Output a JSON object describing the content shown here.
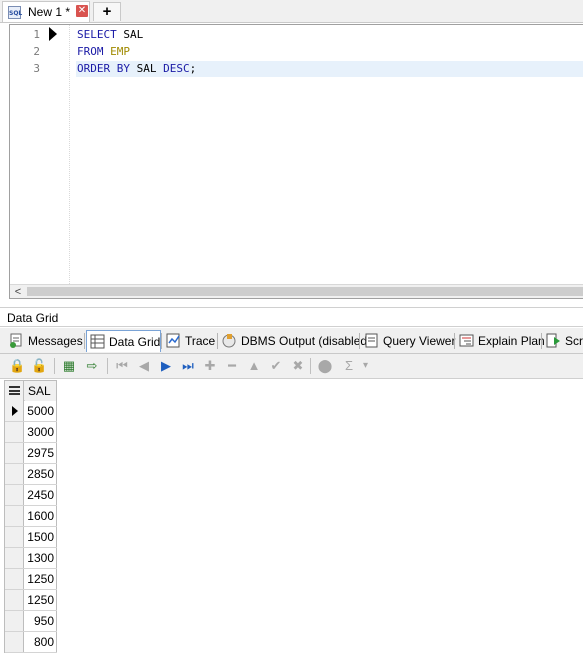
{
  "tab": {
    "sql_icon_text": "SQL",
    "label": "New 1 *",
    "close": "✕",
    "new_tab": "+"
  },
  "editor": {
    "lines": [
      {
        "num": "1",
        "parts": [
          {
            "t": "SELECT",
            "k": "kw"
          },
          {
            "t": " SAL",
            "k": "plain"
          }
        ]
      },
      {
        "num": "2",
        "parts": [
          {
            "t": "FROM",
            "k": "kw"
          },
          {
            "t": " EMP",
            "k": "tbl"
          }
        ]
      },
      {
        "num": "3",
        "parts": [
          {
            "t": "ORDER BY",
            "k": "kw"
          },
          {
            "t": " SAL ",
            "k": "plain"
          },
          {
            "t": "DESC",
            "k": "kw"
          },
          {
            "t": ";",
            "k": "plain"
          }
        ]
      }
    ],
    "scroll_left": "<"
  },
  "results": {
    "caption": "Data Grid",
    "tabs": [
      {
        "label": "Messages",
        "icon": "messages-icon",
        "active": false
      },
      {
        "label": "Data Grid",
        "icon": "data-grid-icon",
        "active": true
      },
      {
        "label": "Trace",
        "icon": "trace-icon",
        "active": false
      },
      {
        "label": "DBMS Output (disabled)",
        "icon": "dbms-output-icon",
        "active": false
      },
      {
        "label": "Query Viewer",
        "icon": "query-viewer-icon",
        "active": false
      },
      {
        "label": "Explain Plan",
        "icon": "explain-plan-icon",
        "active": false
      },
      {
        "label": "Scr",
        "icon": "script-output-icon",
        "active": false
      }
    ],
    "toolbar": [
      {
        "name": "lock-icon",
        "glyph": "🔒",
        "enabled": false
      },
      {
        "name": "unlock-icon",
        "glyph": "🔓",
        "enabled": false
      },
      {
        "name": "export-grid-icon",
        "glyph": "▦",
        "enabled": true
      },
      {
        "name": "export-data-icon",
        "glyph": "⇨",
        "enabled": true
      },
      {
        "name": "first-record-icon",
        "glyph": "⏮",
        "enabled": false
      },
      {
        "name": "prior-record-icon",
        "glyph": "◀",
        "enabled": false
      },
      {
        "name": "next-record-icon",
        "glyph": "▶",
        "enabled": true
      },
      {
        "name": "last-record-icon",
        "glyph": "⏭",
        "enabled": true
      },
      {
        "name": "insert-record-icon",
        "glyph": "✚",
        "enabled": false
      },
      {
        "name": "delete-record-icon",
        "glyph": "━",
        "enabled": false
      },
      {
        "name": "edit-record-icon",
        "glyph": "▲",
        "enabled": false
      },
      {
        "name": "post-edit-icon",
        "glyph": "✔",
        "enabled": false
      },
      {
        "name": "cancel-edit-icon",
        "glyph": "✖",
        "enabled": false
      },
      {
        "name": "filter-icon",
        "glyph": "⬤",
        "enabled": false
      },
      {
        "name": "sum-icon",
        "glyph": "Σ",
        "enabled": false
      },
      {
        "name": "sum-dropdown-icon",
        "glyph": "▾",
        "enabled": false
      }
    ],
    "grid": {
      "column": "SAL",
      "rows": [
        "5000",
        "3000",
        "2975",
        "2850",
        "2450",
        "1600",
        "1500",
        "1300",
        "1250",
        "1250",
        "950",
        "800"
      ]
    }
  },
  "colors": {
    "keyword": "#1a1aa6",
    "table": "#a08a00",
    "current_line": "#e7f1fb",
    "accent": "#7aa3d6"
  }
}
